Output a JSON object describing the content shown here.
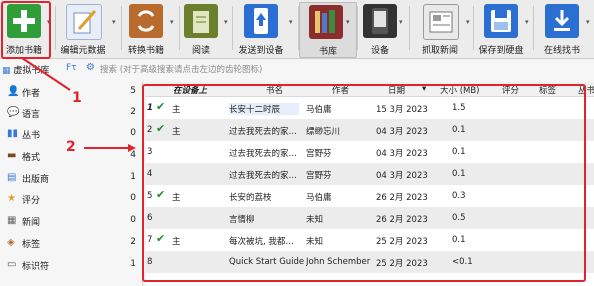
{
  "toolbar": {
    "items": [
      {
        "label": "添加书籍",
        "icon": "add-book-icon",
        "color": "#2f9e39"
      },
      {
        "label": "编辑元数据",
        "icon": "edit-metadata-icon",
        "color": "#3a78d2"
      },
      {
        "label": "转换书籍",
        "icon": "convert-book-icon",
        "color": "#b86b2c"
      },
      {
        "label": "阅读",
        "icon": "read-icon",
        "color": "#6b7f2d"
      },
      {
        "label": "发送到设备",
        "icon": "send-to-device-icon",
        "color": "#2a6fd1"
      },
      {
        "label": "书库",
        "icon": "library-icon",
        "color": "#8b2d2d"
      },
      {
        "label": "设备",
        "icon": "device-icon",
        "color": "#333333"
      },
      {
        "label": "抓取新闻",
        "icon": "fetch-news-icon",
        "color": "#888888"
      },
      {
        "label": "保存到硬盘",
        "icon": "save-to-disk-icon",
        "color": "#2a6fd1"
      },
      {
        "label": "在线找书",
        "icon": "find-books-icon",
        "color": "#2a6fd1"
      }
    ]
  },
  "search": {
    "virtual_library": "虚拟书库",
    "placeholder": "搜索 (对于高级搜索请点击左边的齿轮图标)"
  },
  "sidebar": {
    "items": [
      {
        "label": "作者",
        "count": "5",
        "icon": "author-icon"
      },
      {
        "label": "语言",
        "count": "2",
        "icon": "language-icon"
      },
      {
        "label": "丛书",
        "count": "0",
        "icon": "series-icon"
      },
      {
        "label": "格式",
        "count": "4",
        "icon": "format-icon"
      },
      {
        "label": "出版商",
        "count": "1",
        "icon": "publisher-icon"
      },
      {
        "label": "评分",
        "count": "0",
        "icon": "rating-icon"
      },
      {
        "label": "新闻",
        "count": "0",
        "icon": "news-icon"
      },
      {
        "label": "标签",
        "count": "2",
        "icon": "tags-icon"
      },
      {
        "label": "标识符",
        "count": "1",
        "icon": "identifier-icon"
      }
    ]
  },
  "table": {
    "headers": {
      "on_device": "在设备上",
      "title": "书名",
      "author": "作者",
      "date": "日期",
      "size": "大小 (MB)",
      "rating": "评分",
      "tags": "标签",
      "series": "丛书"
    },
    "rows": [
      {
        "num": "1",
        "check": "✔",
        "device": "主",
        "title": "长安十二时辰",
        "author": "马伯庸",
        "date": "15 3月 2023",
        "size": "1.5"
      },
      {
        "num": "2",
        "check": "✔",
        "device": "主",
        "title": "过去我死去的家…",
        "author": "缥缈忘川",
        "date": "04 3月 2023",
        "size": "0.1"
      },
      {
        "num": "3",
        "check": "",
        "device": "",
        "title": "过去我死去的家…",
        "author": "宫野芬",
        "date": "04 3月 2023",
        "size": "0.1"
      },
      {
        "num": "4",
        "check": "",
        "device": "",
        "title": "过去我死去的家…",
        "author": "宫野芬",
        "date": "04 3月 2023",
        "size": "0.1"
      },
      {
        "num": "5",
        "check": "✔",
        "device": "主",
        "title": "长安的荔枝",
        "author": "马伯庸",
        "date": "26 2月 2023",
        "size": "0.3"
      },
      {
        "num": "6",
        "check": "",
        "device": "",
        "title": "言情柳",
        "author": "未知",
        "date": "26 2月 2023",
        "size": "0.5"
      },
      {
        "num": "7",
        "check": "✔",
        "device": "主",
        "title": "每次被坑, 我都…",
        "author": "未知",
        "date": "25 2月 2023",
        "size": "0.1"
      },
      {
        "num": "8",
        "check": "",
        "device": "",
        "title": "Quick Start Guide",
        "author": "John Schember",
        "date": "25 2月 2023",
        "size": "<0.1"
      }
    ]
  },
  "annotations": {
    "one": "1",
    "two": "2",
    "color": "#e1232e"
  }
}
